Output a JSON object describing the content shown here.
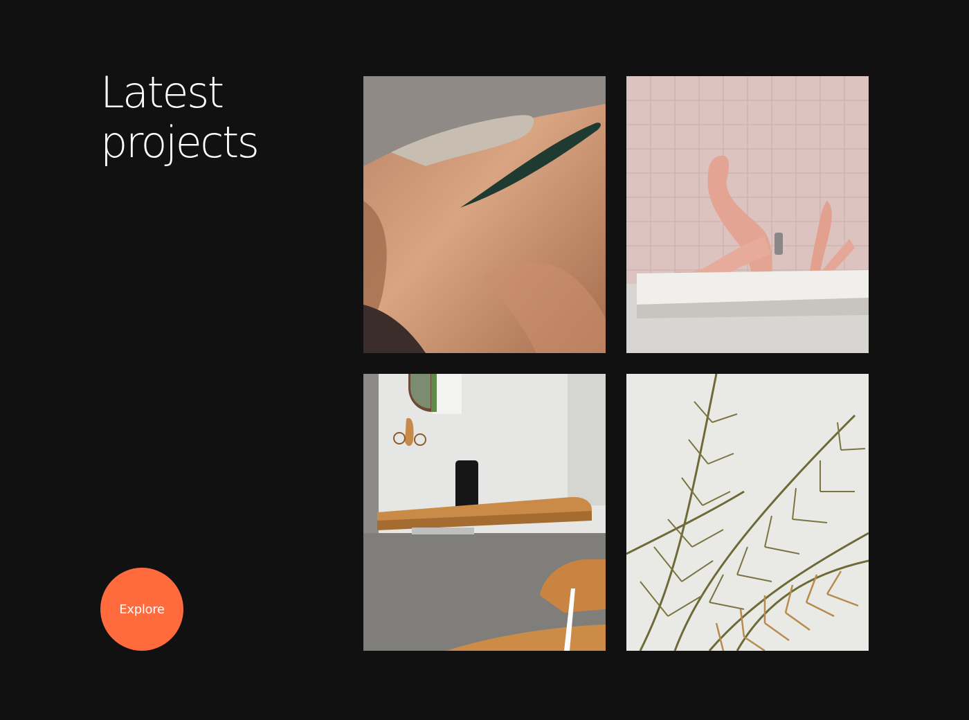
{
  "heading": {
    "line1": "Latest",
    "line2": "projects"
  },
  "explore_button": {
    "label": "Explore"
  },
  "colors": {
    "background": "#111111",
    "accent": "#ff6b3d",
    "text": "#ffffff"
  },
  "projects": [
    {
      "image": "skin-leaf-photo"
    },
    {
      "image": "bathtub-legs-photo"
    },
    {
      "image": "desk-shelf-photo"
    },
    {
      "image": "palm-leaves-photo"
    }
  ]
}
